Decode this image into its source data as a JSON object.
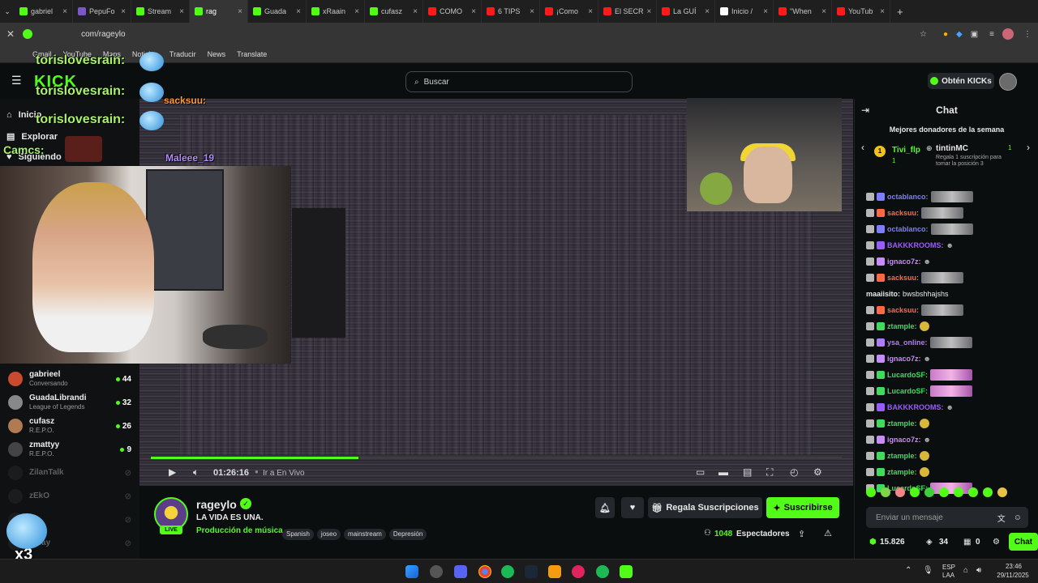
{
  "browser": {
    "tabs": [
      {
        "label": "gabriel",
        "color": "#53fc18"
      },
      {
        "label": "PepuFo",
        "color": "#7b58c8"
      },
      {
        "label": "Stream",
        "color": "#53fc18"
      },
      {
        "label": "rag",
        "color": "#53fc18",
        "active": true
      },
      {
        "label": "Guada",
        "color": "#53fc18"
      },
      {
        "label": "xRaain",
        "color": "#53fc18"
      },
      {
        "label": "cufasz",
        "color": "#53fc18"
      },
      {
        "label": "COMO",
        "color": "#ff1a1a"
      },
      {
        "label": "6 TIPS",
        "color": "#ff1a1a"
      },
      {
        "label": "¡Como",
        "color": "#ff1a1a"
      },
      {
        "label": "El SECR",
        "color": "#ff1a1a"
      },
      {
        "label": "La GUÍ",
        "color": "#ff1a1a"
      },
      {
        "label": "Inicio /",
        "color": "#ffffff"
      },
      {
        "label": "\"When",
        "color": "#ff1a1a"
      },
      {
        "label": "YouTub",
        "color": "#ff1a1a"
      }
    ],
    "url": "com/rageylo",
    "bookmarks": [
      "Gmail",
      "YouTube",
      "Maps",
      "Noticias",
      "Traducir",
      "News",
      "Translate"
    ]
  },
  "header": {
    "logo": "KICK",
    "search_placeholder": "Buscar",
    "get_kicks": "Obtén KICKs"
  },
  "sidebar": {
    "nav": [
      "Inicio",
      "Explorar",
      "Siguiendo"
    ],
    "channels": [
      {
        "name": "gabrieel",
        "sub": "Conversando",
        "count": "44",
        "live": true
      },
      {
        "name": "GuadaLibrandi",
        "sub": "League of Legends",
        "count": "32",
        "live": true
      },
      {
        "name": "cufasz",
        "sub": "R.E.P.O.",
        "count": "26",
        "live": true
      },
      {
        "name": "zmattyy",
        "sub": "R.E.P.O.",
        "count": "9",
        "live": true
      },
      {
        "name": "ZilanTalk",
        "sub": "",
        "count": "",
        "live": false
      },
      {
        "name": "zEkO",
        "sub": "",
        "count": "",
        "live": false
      },
      {
        "name": "co",
        "sub": "",
        "count": "",
        "live": false
      },
      {
        "name": "crsay",
        "sub": "",
        "count": "",
        "live": false
      }
    ]
  },
  "overlays": {
    "user1": "torislovesrain:",
    "user2": "torislovesrain:",
    "user3": "torislovesrain:",
    "camcs": "Camcs:",
    "maleee": "Maleee_19",
    "sacksuu": "sacksuu:",
    "x3": "x3"
  },
  "player": {
    "time": "01:26:16",
    "go_live": "Ir a En Vivo",
    "progress": 0.3
  },
  "stream": {
    "streamer": "rageylo",
    "title": "LA VIDA ES UNA.",
    "category": "Producción de música",
    "tags": [
      "Spanish",
      "joseo",
      "mainstream",
      "Depresión"
    ],
    "live_label": "LIVE",
    "gift_subs": "Regala Suscripciones",
    "subscribe": "Suscribirse",
    "viewers": "1048",
    "viewers_label": "Espectadores"
  },
  "chat": {
    "title": "Chat",
    "top_donors_title": "Mejores donadores de la semana",
    "donor1": "Tivi_flp",
    "donor1_count": "1",
    "donor2": "tintinMC",
    "donor2_count": "1",
    "donor2_note": "Regala 1 suscripción para tomar la posición 3",
    "messages": [
      {
        "user": "octablanco:",
        "color": "#7d7dff",
        "emote": "gray"
      },
      {
        "user": "sacksuu:",
        "color": "#ff6a3d",
        "emote": "gray"
      },
      {
        "user": "octablanco:",
        "color": "#7d7dff",
        "emote": "gray"
      },
      {
        "user": "BAKKKROOMS:",
        "color": "#9a5cff",
        "emote": "none"
      },
      {
        "user": "ignaco7z:",
        "color": "#c88cff",
        "emote": "none"
      },
      {
        "user": "sacksuu:",
        "color": "#ff6a3d",
        "emote": "gray"
      },
      {
        "user": "maaiisito:",
        "color": "#e8e8e8",
        "text": "bwsbshhajshs"
      },
      {
        "user": "sacksuu:",
        "color": "#ff6a3d",
        "emote": "gray"
      },
      {
        "user": "ztample:",
        "color": "#3ddc5b",
        "emote": "small"
      },
      {
        "user": "ysa_online:",
        "color": "#b07cff",
        "emote": "gray"
      },
      {
        "user": "ignaco7z:",
        "color": "#c88cff",
        "emote": "none"
      },
      {
        "user": "LucardoSF:",
        "color": "#3ddc5b",
        "emote": "pink"
      },
      {
        "user": "LucardoSF:",
        "color": "#3ddc5b",
        "emote": "pink"
      },
      {
        "user": "BAKKKROOMS:",
        "color": "#9a5cff",
        "emote": "none"
      },
      {
        "user": "ztample:",
        "color": "#3ddc5b",
        "emote": "small"
      },
      {
        "user": "ignaco7z:",
        "color": "#c88cff",
        "emote": "none"
      },
      {
        "user": "ztample:",
        "color": "#3ddc5b",
        "emote": "small"
      },
      {
        "user": "ztample:",
        "color": "#3ddc5b",
        "emote": "small"
      },
      {
        "user": "LucardoSF:",
        "color": "#3ddc5b",
        "emote": "pink"
      }
    ],
    "input_placeholder": "Enviar un mensaje",
    "points": "15.826",
    "stat2": "34",
    "stat3": "0",
    "chat_button": "Chat"
  },
  "taskbar": {
    "lang": "ESP",
    "lang2": "LAA",
    "time": "23:46",
    "date": "29/11/2025"
  },
  "colors": {
    "kick_green": "#53fc18",
    "bg": "#0b0e0f",
    "panel": "#0f1112"
  }
}
